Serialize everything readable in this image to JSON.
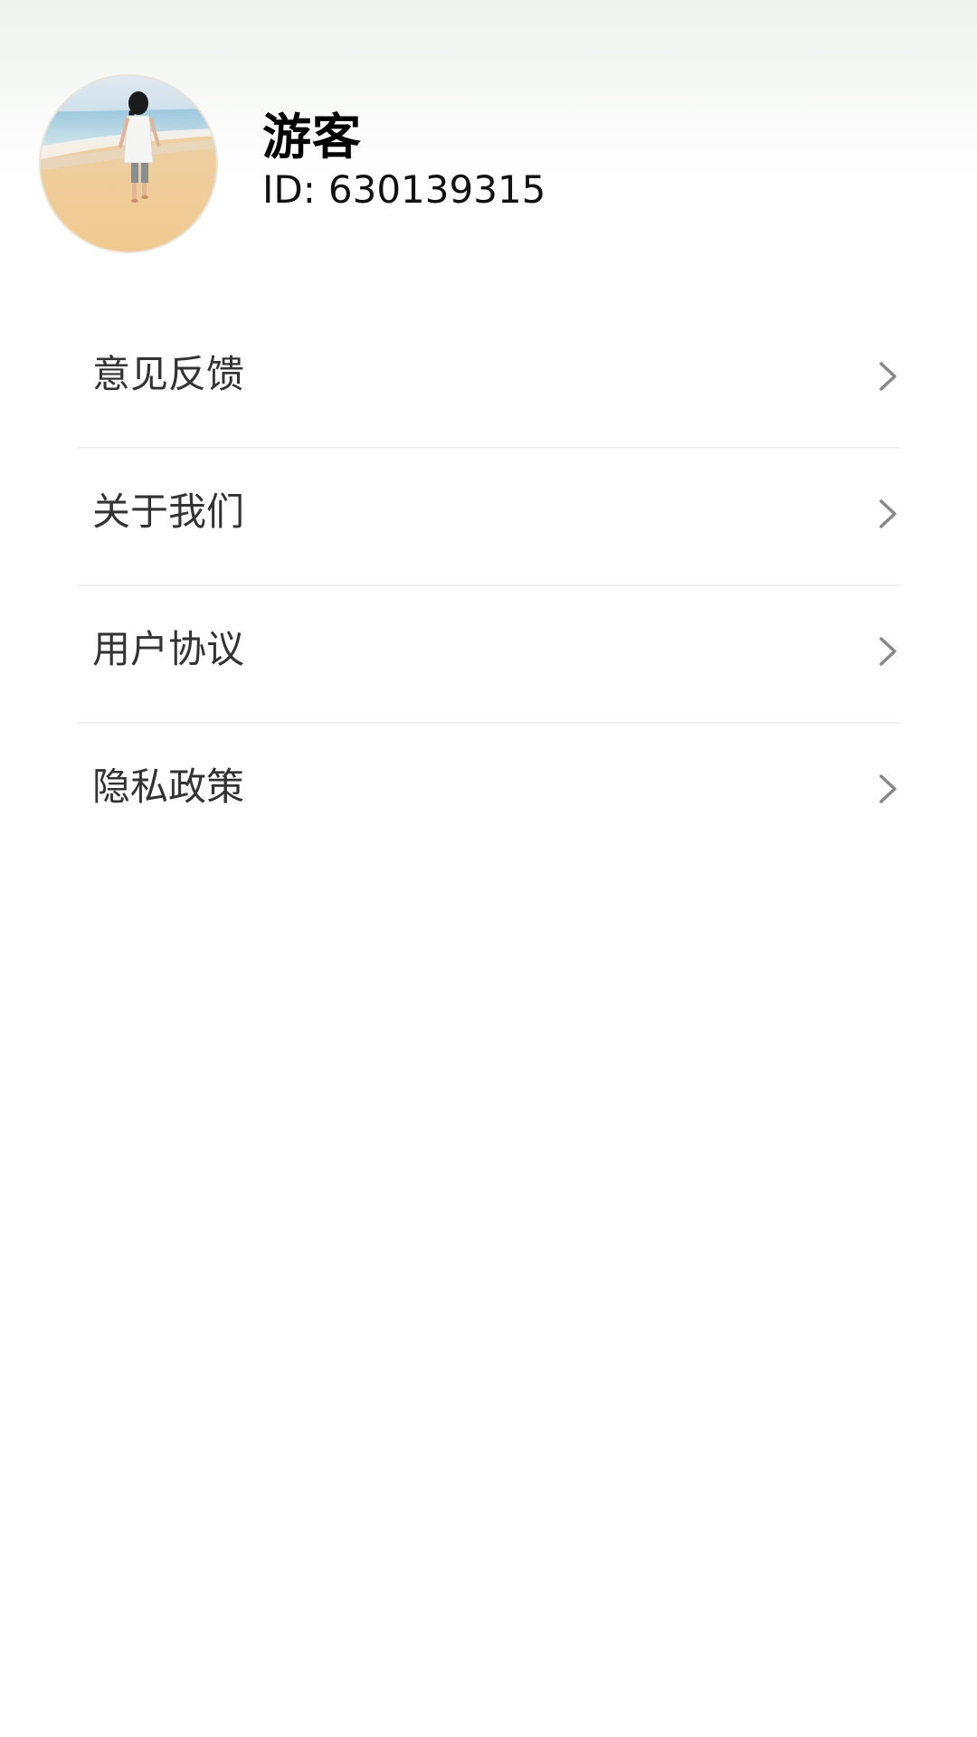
{
  "profile": {
    "name": "游客",
    "id_label": "ID:",
    "id_value": "630139315",
    "avatar_icon": "avatar-beach-photo"
  },
  "menu": {
    "items": [
      {
        "label": "意见反馈",
        "icon": "chevron-right-icon"
      },
      {
        "label": "关于我们",
        "icon": "chevron-right-icon"
      },
      {
        "label": "用户协议",
        "icon": "chevron-right-icon"
      },
      {
        "label": "隐私政策",
        "icon": "chevron-right-icon"
      }
    ]
  },
  "colors": {
    "label_text": "#333333",
    "divider": "#f0f0f0",
    "chevron": "#888888"
  }
}
